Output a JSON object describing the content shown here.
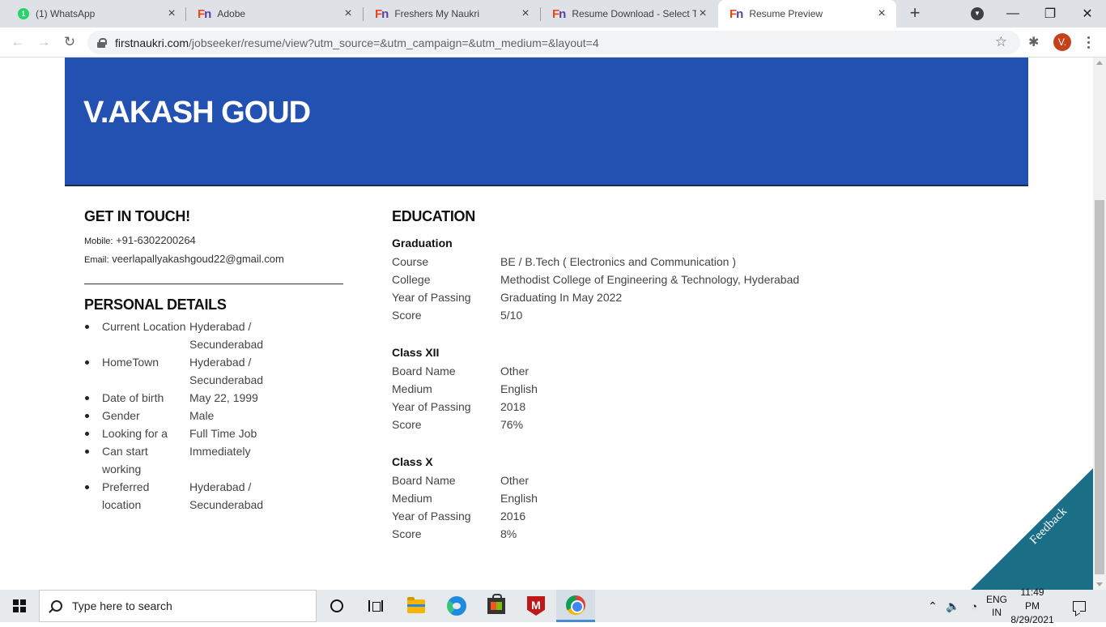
{
  "browser": {
    "tabs": [
      {
        "title": "(1) WhatsApp",
        "favicon": "whatsapp-icon",
        "active": false
      },
      {
        "title": "Adobe",
        "favicon": "firstnaukri-icon",
        "active": false
      },
      {
        "title": "Freshers My Naukri",
        "favicon": "firstnaukri-icon",
        "active": false
      },
      {
        "title": "Resume Download - Select Te",
        "favicon": "firstnaukri-icon",
        "active": false
      },
      {
        "title": "Resume Preview",
        "favicon": "firstnaukri-icon",
        "active": true
      }
    ],
    "whatsapp_badge": "1",
    "url_domain": "firstnaukri.com",
    "url_path": "/jobseeker/resume/view?utm_source=&utm_campaign=&utm_medium=&layout=4",
    "profile_initial": "V."
  },
  "resume": {
    "name": "V.AKASH GOUD",
    "contact": {
      "title": "GET IN TOUCH!",
      "mobile_label": "Mobile:",
      "mobile": "+91-6302200264",
      "email_label": "Email:",
      "email": "veerlapallyakashgoud22@gmail.com"
    },
    "personal": {
      "title": "PERSONAL DETAILS",
      "items": [
        {
          "label": "Current Location",
          "value": "Hyderabad / Secunderabad"
        },
        {
          "label": "HomeTown",
          "value": "Hyderabad / Secunderabad"
        },
        {
          "label": "Date of birth",
          "value": "May 22, 1999"
        },
        {
          "label": "Gender",
          "value": "Male"
        },
        {
          "label": "Looking for a",
          "value": "Full Time Job"
        },
        {
          "label": "Can start working",
          "value": "Immediately"
        },
        {
          "label": "Preferred location",
          "value": "Hyderabad / Secunderabad"
        }
      ]
    },
    "education": {
      "title": "EDUCATION",
      "blocks": [
        {
          "heading": "Graduation",
          "rows": [
            {
              "label": "Course",
              "value": "BE / B.Tech ( Electronics and Communication )"
            },
            {
              "label": "College",
              "value": "Methodist College of Engineering & Technology, Hyderabad"
            },
            {
              "label": "Year of Passing",
              "value": "Graduating In May 2022"
            },
            {
              "label": "Score",
              "value": "5/10"
            }
          ]
        },
        {
          "heading": "Class XII",
          "rows": [
            {
              "label": "Board Name",
              "value": "Other"
            },
            {
              "label": "Medium",
              "value": "English"
            },
            {
              "label": "Year of Passing",
              "value": "2018"
            },
            {
              "label": "Score",
              "value": "76%"
            }
          ]
        },
        {
          "heading": "Class X",
          "rows": [
            {
              "label": "Board Name",
              "value": "Other"
            },
            {
              "label": "Medium",
              "value": "English"
            },
            {
              "label": "Year of Passing",
              "value": "2016"
            },
            {
              "label": "Score",
              "value": "8%"
            }
          ]
        }
      ]
    },
    "feedback_label": "Feedback"
  },
  "taskbar": {
    "search_placeholder": "Type here to search",
    "lang_top": "ENG",
    "lang_bottom": "IN",
    "time": "11:49 PM",
    "date": "8/29/2021"
  },
  "colors": {
    "banner": "#2351b2",
    "feedback": "#1a6e86"
  }
}
